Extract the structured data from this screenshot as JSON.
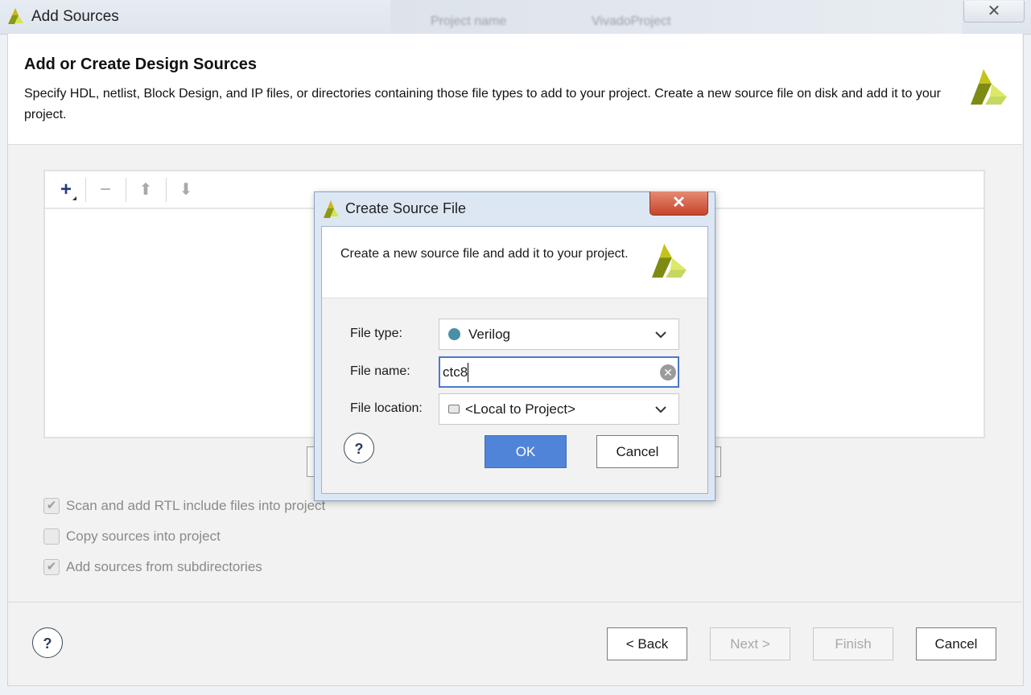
{
  "window": {
    "title": "Add Sources",
    "background_text": [
      "Project name",
      "VivadoProject"
    ],
    "close_glyph": "✕"
  },
  "header": {
    "title": "Add or Create Design Sources",
    "description": "Specify HDL, netlist, Block Design, and IP files, or directories containing those file types to add to your project. Create a new source file on disk and add it to your project.",
    "logo_icon": "xilinx-logo-icon"
  },
  "toolbar": {
    "add": "+",
    "remove": "−",
    "move_up": "⬆",
    "move_down": "⬇"
  },
  "options": [
    {
      "label": "Scan and add RTL include files into project",
      "checked": true
    },
    {
      "label": "Copy sources into project",
      "checked": false
    },
    {
      "label": "Add sources from subdirectories",
      "checked": true
    }
  ],
  "footer": {
    "help": "?",
    "back": "< Back",
    "next": "Next >",
    "finish": "Finish",
    "cancel": "Cancel"
  },
  "dialog": {
    "title": "Create Source File",
    "close_glyph": "✕",
    "description": "Create a new source file and add it to your project.",
    "file_type_label": "File type:",
    "file_type_value": "Verilog",
    "file_name_label": "File name:",
    "file_name_value": "ctc8",
    "file_location_label": "File location:",
    "file_location_value": "<Local to Project>",
    "help": "?",
    "ok": "OK",
    "cancel": "Cancel",
    "accent_color": "#4f84d8"
  }
}
